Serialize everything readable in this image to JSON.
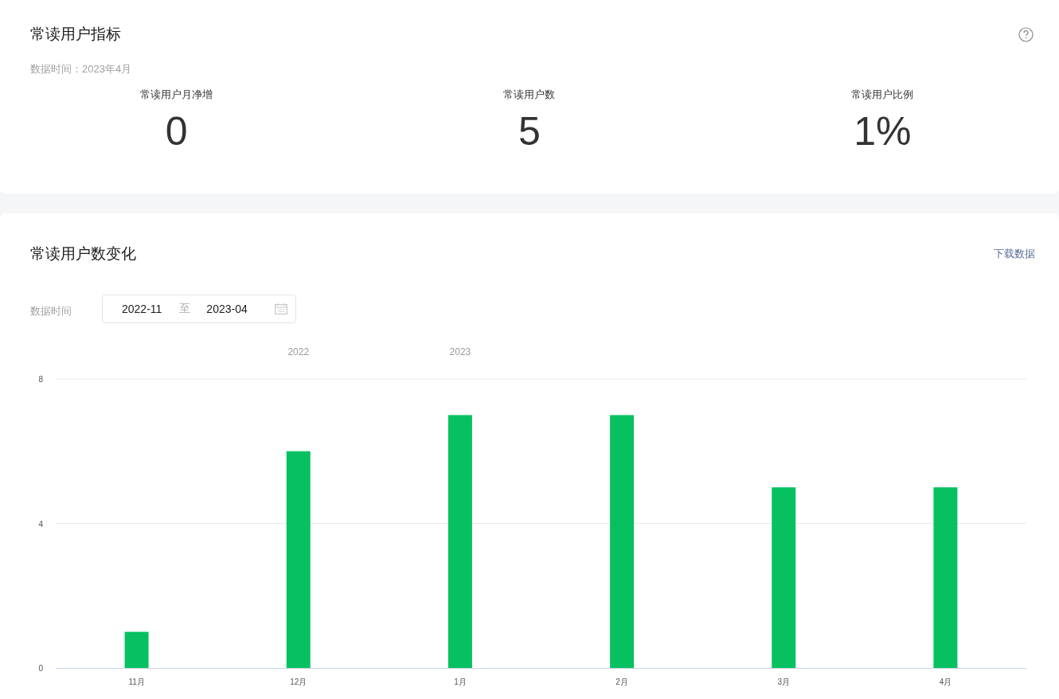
{
  "metrics": {
    "title": "常读用户指标",
    "data_time": "数据时间：2023年4月",
    "items": [
      {
        "label": "常读用户月净增",
        "value": "0"
      },
      {
        "label": "常读用户数",
        "value": "5"
      },
      {
        "label": "常读用户比例",
        "value": "1%"
      }
    ]
  },
  "trend": {
    "title": "常读用户数变化",
    "download_link": "下载数据",
    "filter_label": "数据时间",
    "date_range": {
      "start": "2022-11",
      "separator": "至",
      "end": "2023-04"
    },
    "year_labels": [
      "2022",
      "2023"
    ],
    "chart_data": {
      "type": "bar",
      "categories": [
        "11月",
        "12月",
        "1月",
        "2月",
        "3月",
        "4月"
      ],
      "series": [
        {
          "color": "#07c160",
          "values": [
            1,
            6,
            7,
            7,
            5,
            5
          ]
        }
      ],
      "ylim": [
        0,
        8
      ],
      "yticks": [
        0,
        4,
        8
      ]
    }
  }
}
